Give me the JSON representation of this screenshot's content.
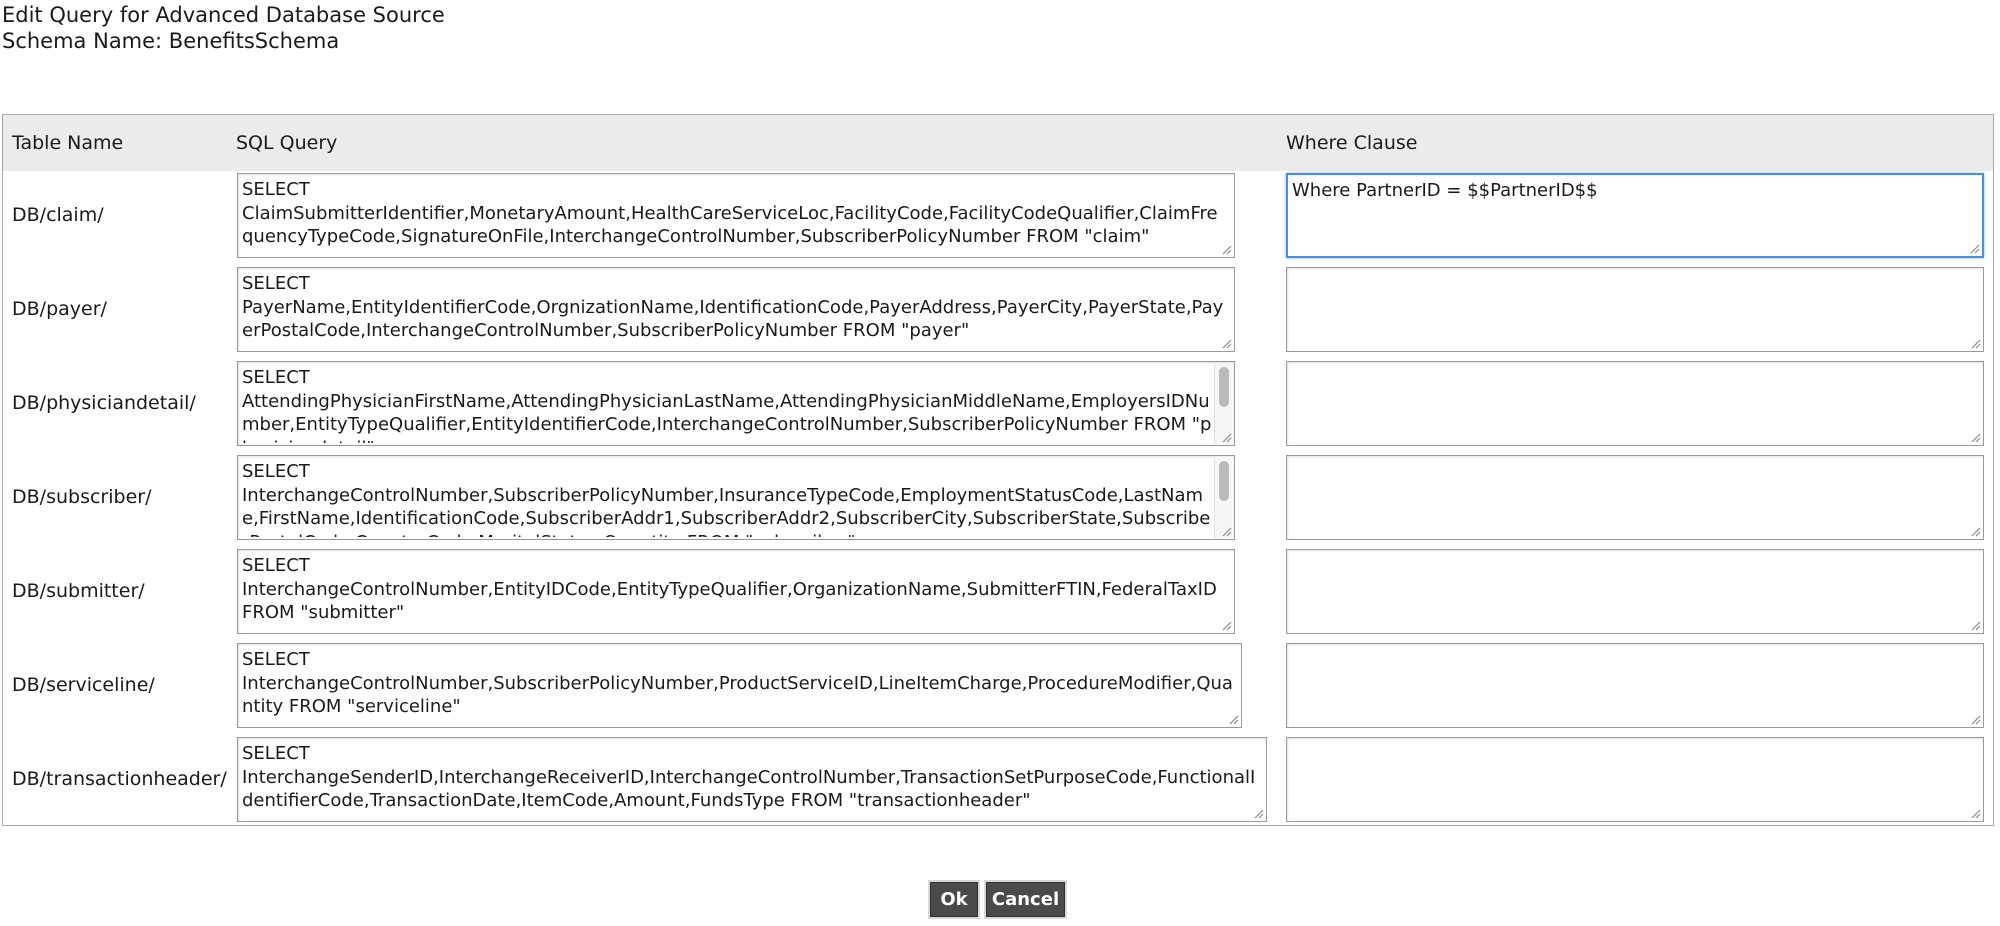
{
  "header": {
    "title": "Edit Query for Advanced Database Source",
    "schema_line": "Schema Name: BenefitsSchema"
  },
  "columns": {
    "table_name": "Table Name",
    "sql_query": "SQL Query",
    "where_clause": "Where Clause"
  },
  "rows": [
    {
      "table": "DB/claim/",
      "sql": "SELECT\nClaimSubmitterIdentifier,MonetaryAmount,HealthCareServiceLoc,FacilityCode,FacilityCodeQualifier,ClaimFrequencyTypeCode,SignatureOnFile,InterchangeControlNumber,SubscriberPolicyNumber FROM \"claim\"",
      "where": "Where PartnerID = $$PartnerID$$"
    },
    {
      "table": "DB/payer/",
      "sql": "SELECT\nPayerName,EntityIdentifierCode,OrgnizationName,IdentificationCode,PayerAddress,PayerCity,PayerState,PayerPostalCode,InterchangeControlNumber,SubscriberPolicyNumber FROM \"payer\"",
      "where": ""
    },
    {
      "table": "DB/physiciandetail/",
      "sql": "SELECT\nAttendingPhysicianFirstName,AttendingPhysicianLastName,AttendingPhysicianMiddleName,EmployersIDNumber,EntityTypeQualifier,EntityIdentifierCode,InterchangeControlNumber,SubscriberPolicyNumber FROM \"physiciandetail\"",
      "where": ""
    },
    {
      "table": "DB/subscriber/",
      "sql": "SELECT\nInterchangeControlNumber,SubscriberPolicyNumber,InsuranceTypeCode,EmploymentStatusCode,LastName,FirstName,IdentificationCode,SubscriberAddr1,SubscriberAddr2,SubscriberCity,SubscriberState,SubscriberPostalCode,CountryCode,MaritalStatus,Quantity FROM \"subscriber\"",
      "where": ""
    },
    {
      "table": "DB/submitter/",
      "sql": "SELECT\nInterchangeControlNumber,EntityIDCode,EntityTypeQualifier,OrganizationName,SubmitterFTIN,FederalTaxID FROM \"submitter\"",
      "where": ""
    },
    {
      "table": "DB/serviceline/",
      "sql": "SELECT\nInterchangeControlNumber,SubscriberPolicyNumber,ProductServiceID,LineItemCharge,ProcedureModifier,Quantity FROM \"serviceline\"",
      "where": ""
    },
    {
      "table": "DB/transactionheader/",
      "sql": "SELECT\nInterchangeSenderID,InterchangeReceiverID,InterchangeControlNumber,TransactionSetPurposeCode,FunctionalIdentifierCode,TransactionDate,ItemCode,Amount,FundsType FROM \"transactionheader\"",
      "where": ""
    }
  ],
  "buttons": {
    "ok": "Ok",
    "cancel": "Cancel"
  },
  "colors": {
    "focus_border": "#4a90d9",
    "button_bg": "#4a4a4a",
    "header_bg": "#ececec"
  }
}
